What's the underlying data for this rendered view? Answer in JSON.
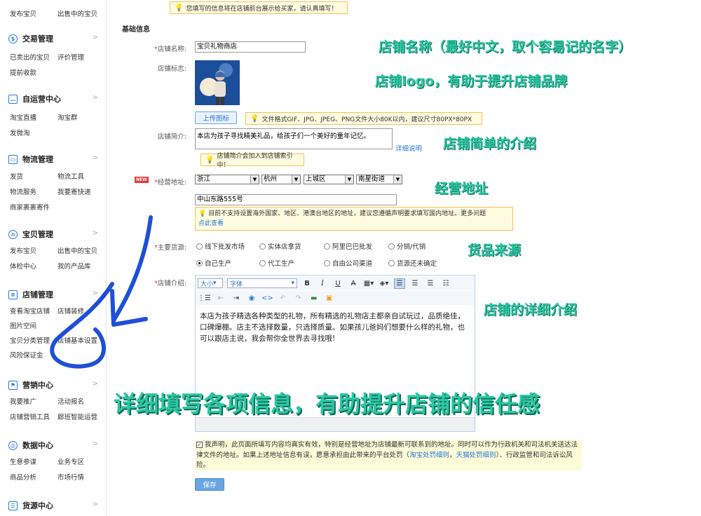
{
  "sidebar": {
    "top_links": [
      "发布宝贝",
      "出售中的宝贝"
    ],
    "sections": [
      {
        "title": "交易管理",
        "icon": "trade-icon",
        "links": [
          "已卖出的宝贝",
          "评价管理",
          "提前收款"
        ]
      },
      {
        "title": "自运营中心",
        "icon": "chat-icon",
        "links": [
          "淘宝直播",
          "淘宝群",
          "发微淘"
        ]
      },
      {
        "title": "物流管理",
        "icon": "truck-icon",
        "links": [
          "发货",
          "物流工具",
          "物流服务",
          "我要寄快递",
          "商家裹裹寄件"
        ]
      },
      {
        "title": "宝贝管理",
        "icon": "bag-icon",
        "links": [
          "发布宝贝",
          "出售中的宝贝",
          "体检中心",
          "我的产品库"
        ]
      },
      {
        "title": "店铺管理",
        "icon": "store-icon",
        "links": [
          "查看淘宝店铺",
          "店铺装修",
          "图片空间",
          "",
          "宝贝分类管理",
          "店铺基本设置",
          "风险保证金"
        ]
      },
      {
        "title": "营销中心",
        "icon": "flag-icon",
        "links": [
          "我要推广",
          "活动报名",
          "店铺营销工具",
          "廊班智能运营"
        ]
      },
      {
        "title": "数据中心",
        "icon": "compass-icon",
        "links": [
          "生意参谋",
          "业务专区",
          "商品分析",
          "市场行情"
        ]
      },
      {
        "title": "货源中心",
        "icon": "box-icon",
        "links": []
      }
    ]
  },
  "form": {
    "top_tip": "您填写的信息将在店铺前台展示给买家，请认真填写！",
    "section_title": "基础信息",
    "shop_name_label": "店铺名称:",
    "shop_name_value": "宝贝礼物商店",
    "logo_label": "店铺标志:",
    "upload_button": "上传图标",
    "upload_tip": "文件格式GIF、JPG、JPEG、PNG文件大小80K以内，建议尺寸80PX*80PX",
    "intro_label": "店铺简介:",
    "intro_value": "本店为孩子寻找精美礼品，给孩子们一个美好的童年记忆。",
    "intro_help": "详细说明",
    "intro_tip": "店铺简介会加入到店铺索引中！",
    "new_badge": "NEW",
    "address_label": "经营地址:",
    "province": "浙江",
    "city": "杭州",
    "district": "上城区",
    "street": "南星街道",
    "address_detail": "中山东路555号",
    "address_tip": "目前不支持设置海外国家、地区、港澳台地区的地址，建议您遵循声明要求填写国内地址。更多问题",
    "address_tip_link": "点此查看",
    "source_label": "主要货源:",
    "source_options": [
      "线下批发市场",
      "实体店拿货",
      "阿里巴巴批发",
      "分销/代销",
      "自己生产",
      "代工生产",
      "自由公司渠道",
      "货源还未确定"
    ],
    "detail_label": "店铺介绍:",
    "editor_size": "大小",
    "editor_font": "字体",
    "editor_body": "本店为孩子精选各种类型的礼物，所有精选的礼物店主都亲自试玩过，品质绝佳，口碑爆棚。店主不选择数量，只选择质量。如果孩儿爸妈们想要什么样的礼物，也可以跟店主说，我会帮你全世界去寻找哦!",
    "declare_text": "我声明，此页面所填写内容均真实有效，特别是经营地址为店铺最新可联系到的地址。同时可以作为行政机关和司法机关送达法律文件的地址。如果上述地址信息有误，愿意承担由此带来的平台处罚（",
    "declare_link1": "淘宝处罚细则",
    "declare_sep": "，",
    "declare_link2": "天猫处罚细则",
    "declare_tail": "）、行政监管和司法诉讼风险。",
    "save_button": "保存"
  },
  "annotations": {
    "shop_name": "店铺名称（最好中文，取个容易记的名字）",
    "logo": "店铺logo，有助于提升店铺品牌",
    "intro": "店铺简单的介绍",
    "address": "经营地址",
    "source": "货品来源",
    "detail": "店铺的详细介绍",
    "big": "详细填写各项信息，有助提升店铺的信任感"
  },
  "colors": {
    "accent": "#2a78d6",
    "annotation": "#2cc7a3",
    "arrow": "#1f4fd6",
    "required": "#e4393c"
  }
}
